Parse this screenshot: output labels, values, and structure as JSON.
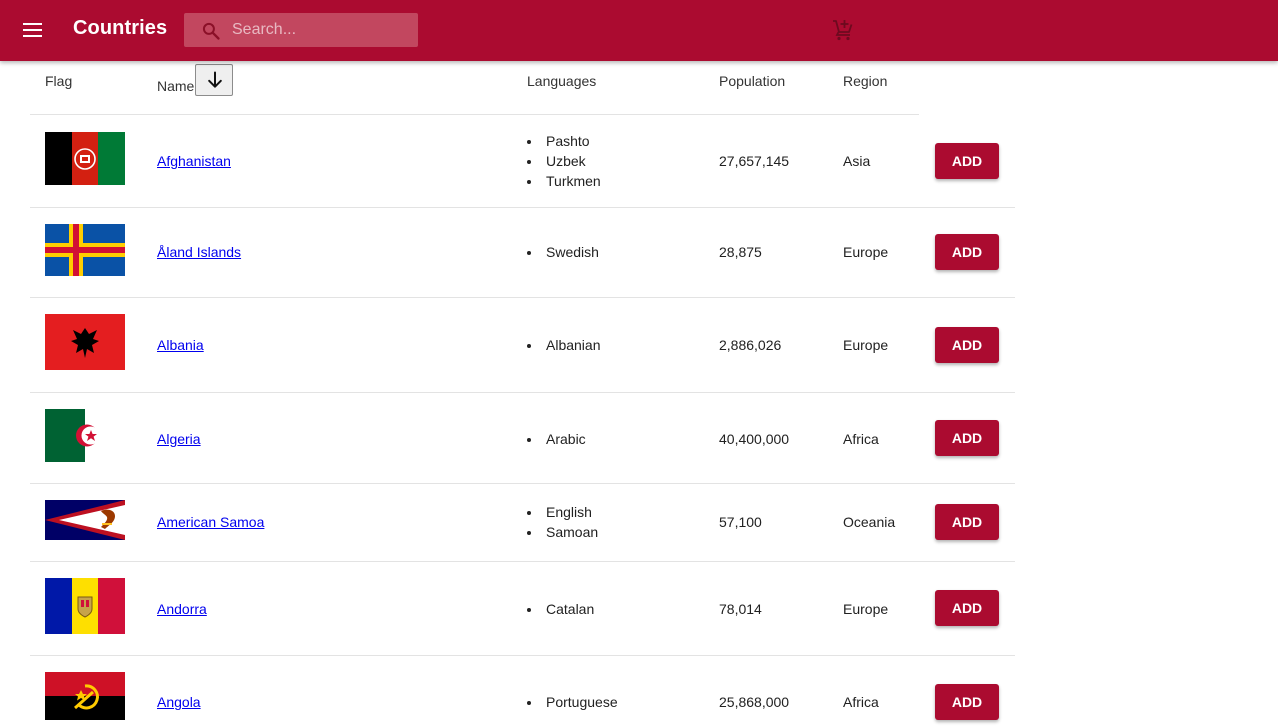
{
  "toolbar": {
    "title": "Countries",
    "search_placeholder": "Search...",
    "menu_icon": "menu-icon",
    "search_icon": "search-icon",
    "cart_icon": "add-shopping-cart-icon",
    "color": "#ab0b30"
  },
  "table": {
    "headers": {
      "flag": "Flag",
      "name": "Name",
      "languages": "Languages",
      "population": "Population",
      "region": "Region"
    },
    "sort_icon": "arrow-down-icon",
    "rows": [
      {
        "name": "Afghanistan",
        "languages": [
          "Pashto",
          "Uzbek",
          "Turkmen"
        ],
        "population": "27,657,145",
        "region": "Asia",
        "add_label": "ADD"
      },
      {
        "name": "Åland Islands",
        "languages": [
          "Swedish"
        ],
        "population": "28,875",
        "region": "Europe",
        "add_label": "ADD"
      },
      {
        "name": "Albania",
        "languages": [
          "Albanian"
        ],
        "population": "2,886,026",
        "region": "Europe",
        "add_label": "ADD"
      },
      {
        "name": "Algeria",
        "languages": [
          "Arabic"
        ],
        "population": "40,400,000",
        "region": "Africa",
        "add_label": "ADD"
      },
      {
        "name": "American Samoa",
        "languages": [
          "English",
          "Samoan"
        ],
        "population": "57,100",
        "region": "Oceania",
        "add_label": "ADD"
      },
      {
        "name": "Andorra",
        "languages": [
          "Catalan"
        ],
        "population": "78,014",
        "region": "Europe",
        "add_label": "ADD"
      },
      {
        "name": "Angola",
        "languages": [
          "Portuguese"
        ],
        "population": "25,868,000",
        "region": "Africa",
        "add_label": "ADD"
      }
    ]
  }
}
